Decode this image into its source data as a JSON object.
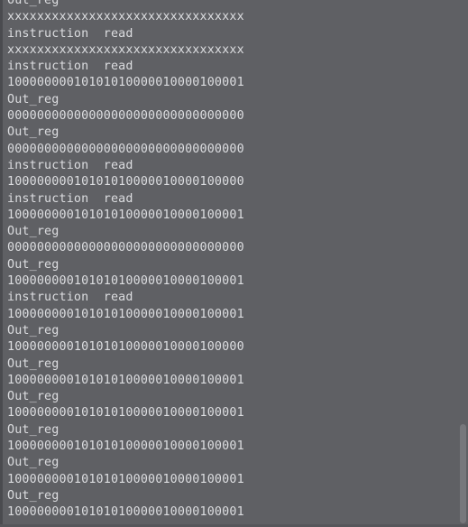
{
  "console": {
    "lines": [
      "Out_reg",
      "xxxxxxxxxxxxxxxxxxxxxxxxxxxxxxxx",
      "instruction  read",
      "xxxxxxxxxxxxxxxxxxxxxxxxxxxxxxxx",
      "instruction  read",
      "10000000010101010000010000100001",
      "Out_reg",
      "00000000000000000000000000000000",
      "Out_reg",
      "00000000000000000000000000000000",
      "instruction  read",
      "10000000010101010000010000100000",
      "instruction  read",
      "10000000010101010000010000100001",
      "Out_reg",
      "00000000000000000000000000000000",
      "Out_reg",
      "10000000010101010000010000100001",
      "instruction  read",
      "10000000010101010000010000100001",
      "Out_reg",
      "10000000010101010000010000100000",
      "Out_reg",
      "10000000010101010000010000100001",
      "Out_reg",
      "10000000010101010000010000100001",
      "Out_reg",
      "10000000010101010000010000100001",
      "Out_reg",
      "10000000010101010000010000100001",
      "Out_reg",
      "10000000010101010000010000100001"
    ]
  },
  "colors": {
    "background": "#5f6064",
    "text": "#dcdde0"
  }
}
